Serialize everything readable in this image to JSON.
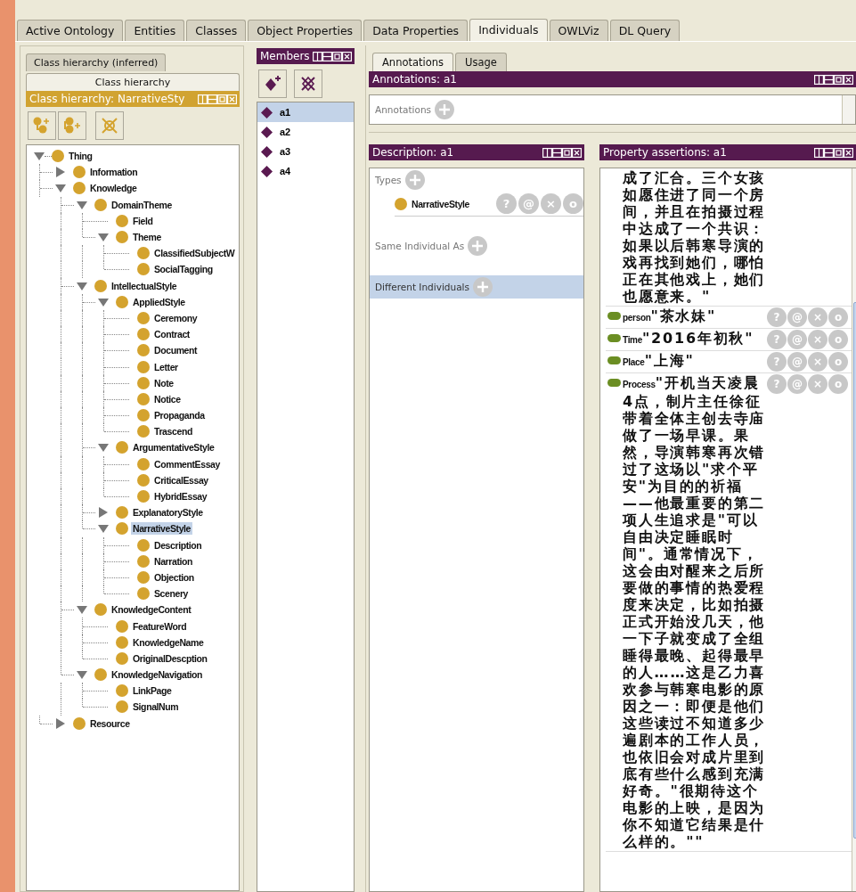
{
  "tabs": [
    {
      "label": "Active Ontology",
      "selected": false
    },
    {
      "label": "Entities",
      "selected": false
    },
    {
      "label": "Classes",
      "selected": false
    },
    {
      "label": "Object Properties",
      "selected": false
    },
    {
      "label": "Data Properties",
      "selected": false
    },
    {
      "label": "Individuals",
      "selected": true
    },
    {
      "label": "OWLViz",
      "selected": false
    },
    {
      "label": "DL Query",
      "selected": false
    }
  ],
  "class_panel": {
    "tabs": [
      {
        "label": "Class hierarchy (inferred)",
        "selected": false
      },
      {
        "label": "Class hierarchy",
        "selected": true
      }
    ],
    "title": "Class hierarchy: NarrativeSty",
    "tree": [
      {
        "label": "Thing",
        "selected": false,
        "expanded": true,
        "children": [
          {
            "label": "Information",
            "selected": false,
            "expanded": false
          },
          {
            "label": "Knowledge",
            "selected": false,
            "expanded": true,
            "children": [
              {
                "label": "DomainTheme",
                "selected": false,
                "expanded": true,
                "children": [
                  {
                    "label": "Field",
                    "selected": false
                  },
                  {
                    "label": "Theme",
                    "selected": false,
                    "expanded": true,
                    "children": [
                      {
                        "label": "ClassifiedSubjectW",
                        "selected": false
                      },
                      {
                        "label": "SocialTagging",
                        "selected": false
                      }
                    ]
                  }
                ]
              },
              {
                "label": "IntellectualStyle",
                "selected": false,
                "expanded": true,
                "children": [
                  {
                    "label": "AppliedStyle",
                    "selected": false,
                    "expanded": true,
                    "children": [
                      {
                        "label": "Ceremony",
                        "selected": false
                      },
                      {
                        "label": "Contract",
                        "selected": false
                      },
                      {
                        "label": "Document",
                        "selected": false
                      },
                      {
                        "label": "Letter",
                        "selected": false
                      },
                      {
                        "label": "Note",
                        "selected": false
                      },
                      {
                        "label": "Notice",
                        "selected": false
                      },
                      {
                        "label": "Propaganda",
                        "selected": false
                      },
                      {
                        "label": "Trascend",
                        "selected": false
                      }
                    ]
                  },
                  {
                    "label": "ArgumentativeStyle",
                    "selected": false,
                    "expanded": true,
                    "children": [
                      {
                        "label": "CommentEssay",
                        "selected": false
                      },
                      {
                        "label": "CriticalEssay",
                        "selected": false
                      },
                      {
                        "label": "HybridEssay",
                        "selected": false
                      }
                    ]
                  },
                  {
                    "label": "ExplanatoryStyle",
                    "selected": false,
                    "expanded": false
                  },
                  {
                    "label": "NarrativeStyle",
                    "selected": true,
                    "expanded": true,
                    "children": [
                      {
                        "label": "Description",
                        "selected": false
                      },
                      {
                        "label": "Narration",
                        "selected": false
                      },
                      {
                        "label": "Objection",
                        "selected": false
                      },
                      {
                        "label": "Scenery",
                        "selected": false
                      }
                    ]
                  }
                ]
              },
              {
                "label": "KnowledgeContent",
                "selected": false,
                "expanded": true,
                "children": [
                  {
                    "label": "FeatureWord",
                    "selected": false
                  },
                  {
                    "label": "KnowledgeName",
                    "selected": false
                  },
                  {
                    "label": "OriginalDescption",
                    "selected": false
                  }
                ]
              },
              {
                "label": "KnowledgeNavigation",
                "selected": false,
                "expanded": true,
                "children": [
                  {
                    "label": "LinkPage",
                    "selected": false
                  },
                  {
                    "label": "SignalNum",
                    "selected": false
                  }
                ]
              }
            ]
          },
          {
            "label": "Resource",
            "selected": false,
            "expanded": false
          }
        ]
      }
    ]
  },
  "members": {
    "title": "Members",
    "items": [
      {
        "label": "a1",
        "selected": true
      },
      {
        "label": "a2",
        "selected": false
      },
      {
        "label": "a3",
        "selected": false
      },
      {
        "label": "a4",
        "selected": false
      }
    ]
  },
  "individual_tabs": [
    {
      "label": "Annotations",
      "selected": true
    },
    {
      "label": "Usage",
      "selected": false
    }
  ],
  "annotations": {
    "title": "Annotations: a1",
    "label": "Annotations"
  },
  "description": {
    "title": "Description: a1",
    "sections": [
      {
        "label": "Types",
        "selected": false,
        "entries": [
          {
            "label": "NarrativeStyle",
            "buttons": [
              "?",
              "@",
              "×",
              "o"
            ]
          }
        ]
      },
      {
        "label": "Same Individual As",
        "selected": false
      },
      {
        "label": "Different Individuals",
        "selected": true
      }
    ]
  },
  "property_assertions": {
    "title": "Property assertions: a1",
    "items": [
      {
        "value": "成了汇合。三个女孩如愿住进了同一个房间，并且在拍摄过程中达成了一个共识：如果以后韩寒导演的戏再找到她们，哪怕正在其他戏上，她们也愿意来。\""
      },
      {
        "property": "person",
        "value": "\"茶水妹\"",
        "buttons": [
          "?",
          "@",
          "×",
          "o"
        ]
      },
      {
        "property": "Time",
        "value": "\"2016年初秋\"",
        "buttons": [
          "?",
          "@",
          "×",
          "o"
        ]
      },
      {
        "property": "Place",
        "value": "\"上海\"",
        "buttons": [
          "?",
          "@",
          "×",
          "o"
        ]
      },
      {
        "property": "Process",
        "value": "\"开机当天凌晨4点，制片主任徐征带着全体主创去寺庙做了一场早课。果然，导演韩寒再次错过了这场以\"求个平安\"为目的的祈福——他最重要的第二项人生追求是\"可以自由决定睡眠时间\"。通常情况下，这会由对醒来之后所要做的事情的热爱程度来决定，比如拍摄正式开始没几天，他一下子就变成了全组睡得最晚、起得最早的人……这是乙力喜欢参与韩寒电影的原因之一：即便是他们这些读过不知道多少遍剧本的工作人员，也依旧会对成片里到底有些什么感到充满好奇。\"很期待这个电影的上映，是因为你不知道它结果是什么样的。\"\"",
        "buttons": [
          "?",
          "@",
          "×",
          "o"
        ]
      }
    ]
  }
}
